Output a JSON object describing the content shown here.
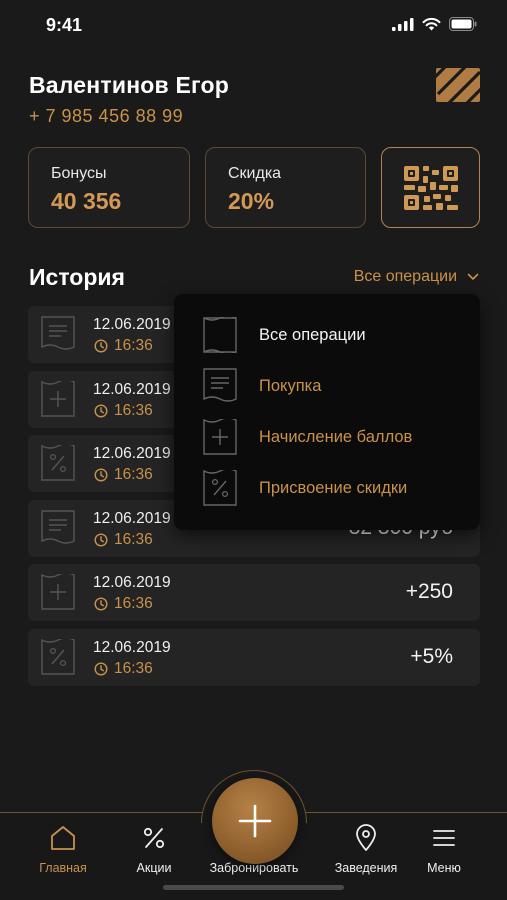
{
  "status_bar": {
    "time": "9:41"
  },
  "profile": {
    "name": "Валентинов Егор",
    "phone": "+ 7 985 456 88 99"
  },
  "cards": {
    "bonus": {
      "label": "Бонусы",
      "value": "40 356"
    },
    "discount": {
      "label": "Скидка",
      "value": "20%"
    }
  },
  "history": {
    "title": "История",
    "filter_label": "Все операции",
    "rows": [
      {
        "icon": "receipt-icon",
        "date": "12.06.2019",
        "time": "16:36",
        "amount": ""
      },
      {
        "icon": "plus-tag-icon",
        "date": "12.06.2019",
        "time": "16:36",
        "amount": ""
      },
      {
        "icon": "percent-tag-icon",
        "date": "12.06.2019",
        "time": "16:36",
        "amount": ""
      },
      {
        "icon": "receipt-icon",
        "date": "12.06.2019",
        "time": "16:36",
        "amount": "32 300 руб"
      },
      {
        "icon": "plus-tag-icon",
        "date": "12.06.2019",
        "time": "16:36",
        "amount": "+250"
      },
      {
        "icon": "percent-tag-icon",
        "date": "12.06.2019",
        "time": "16:36",
        "amount": "+5%"
      }
    ]
  },
  "dropdown": {
    "items": [
      {
        "label": "Все операции",
        "icon": "document-outline-icon",
        "selected": true
      },
      {
        "label": "Покупка",
        "icon": "receipt-icon",
        "selected": false
      },
      {
        "label": "Начисление баллов",
        "icon": "plus-tag-icon",
        "selected": false
      },
      {
        "label": "Присвоение скидки",
        "icon": "percent-tag-icon",
        "selected": false
      }
    ]
  },
  "tabbar": {
    "items": [
      {
        "label": "Главная",
        "icon": "home-icon",
        "active": true
      },
      {
        "label": "Акции",
        "icon": "percent-icon",
        "active": false
      },
      {
        "label": "Забронировать",
        "icon": "plus-icon",
        "active": false
      },
      {
        "label": "Заведения",
        "icon": "location-pin-icon",
        "active": false
      },
      {
        "label": "Меню",
        "icon": "menu-icon",
        "active": false
      }
    ]
  },
  "colors": {
    "accent": "#c8924a",
    "background": "#1a1a1a",
    "card_border": "#5a4a36",
    "row_background": "#242424",
    "dropdown_background": "#0b0b0b"
  }
}
